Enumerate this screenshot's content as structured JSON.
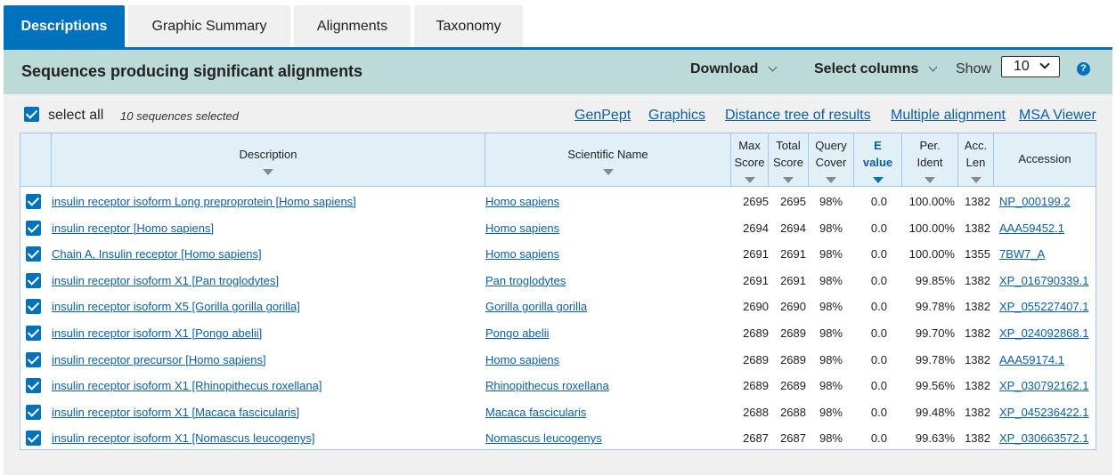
{
  "tabs": [
    "Descriptions",
    "Graphic Summary",
    "Alignments",
    "Taxonomy"
  ],
  "header": {
    "title": "Sequences producing significant alignments",
    "download_label": "Download",
    "select_columns_label": "Select columns",
    "show_label": "Show",
    "show_value": "10",
    "help_icon": "?"
  },
  "selection": {
    "select_all_label": "select all",
    "count_label": "10 sequences selected"
  },
  "links": [
    "GenPept",
    "Graphics",
    "Distance tree of results",
    "Multiple alignment",
    "MSA Viewer"
  ],
  "columns": {
    "description": "Description",
    "scientific_name": "Scientific Name",
    "max_score": [
      "Max",
      "Score"
    ],
    "total_score": [
      "Total",
      "Score"
    ],
    "query_cover": [
      "Query",
      "Cover"
    ],
    "e_value": [
      "E",
      "value"
    ],
    "per_ident": [
      "Per.",
      "Ident"
    ],
    "acc_len": [
      "Acc.",
      "Len"
    ],
    "accession": "Accession"
  },
  "rows": [
    {
      "description": "insulin receptor isoform Long preproprotein [Homo sapiens]",
      "scientific_name": "Homo sapiens",
      "max_score": "2695",
      "total_score": "2695",
      "query_cover": "98%",
      "e_value": "0.0",
      "per_ident": "100.00%",
      "acc_len": "1382",
      "accession": "NP_000199.2"
    },
    {
      "description": "insulin receptor [Homo sapiens]",
      "scientific_name": "Homo sapiens",
      "max_score": "2694",
      "total_score": "2694",
      "query_cover": "98%",
      "e_value": "0.0",
      "per_ident": "100.00%",
      "acc_len": "1382",
      "accession": "AAA59452.1"
    },
    {
      "description": "Chain A, Insulin receptor [Homo sapiens]",
      "scientific_name": "Homo sapiens",
      "max_score": "2691",
      "total_score": "2691",
      "query_cover": "98%",
      "e_value": "0.0",
      "per_ident": "100.00%",
      "acc_len": "1355",
      "accession": "7BW7_A"
    },
    {
      "description": "insulin receptor isoform X1 [Pan troglodytes]",
      "scientific_name": "Pan troglodytes",
      "max_score": "2691",
      "total_score": "2691",
      "query_cover": "98%",
      "e_value": "0.0",
      "per_ident": "99.85%",
      "acc_len": "1382",
      "accession": "XP_016790339.1"
    },
    {
      "description": "insulin receptor isoform X5 [Gorilla gorilla gorilla]",
      "scientific_name": "Gorilla gorilla gorilla",
      "max_score": "2690",
      "total_score": "2690",
      "query_cover": "98%",
      "e_value": "0.0",
      "per_ident": "99.78%",
      "acc_len": "1382",
      "accession": "XP_055227407.1"
    },
    {
      "description": "insulin receptor isoform X1 [Pongo abelii]",
      "scientific_name": "Pongo abelii",
      "max_score": "2689",
      "total_score": "2689",
      "query_cover": "98%",
      "e_value": "0.0",
      "per_ident": "99.70%",
      "acc_len": "1382",
      "accession": "XP_024092868.1"
    },
    {
      "description": "insulin receptor precursor [Homo sapiens]",
      "scientific_name": "Homo sapiens",
      "max_score": "2689",
      "total_score": "2689",
      "query_cover": "98%",
      "e_value": "0.0",
      "per_ident": "99.78%",
      "acc_len": "1382",
      "accession": "AAA59174.1"
    },
    {
      "description": "insulin receptor isoform X1 [Rhinopithecus roxellana]",
      "scientific_name": "Rhinopithecus roxellana",
      "max_score": "2689",
      "total_score": "2689",
      "query_cover": "98%",
      "e_value": "0.0",
      "per_ident": "99.56%",
      "acc_len": "1382",
      "accession": "XP_030792162.1"
    },
    {
      "description": "insulin receptor isoform X1 [Macaca fascicularis]",
      "scientific_name": "Macaca fascicularis",
      "max_score": "2688",
      "total_score": "2688",
      "query_cover": "98%",
      "e_value": "0.0",
      "per_ident": "99.48%",
      "acc_len": "1382",
      "accession": "XP_045236422.1"
    },
    {
      "description": "insulin receptor isoform X1 [Nomascus leucogenys]",
      "scientific_name": "Nomascus leucogenys",
      "max_score": "2687",
      "total_score": "2687",
      "query_cover": "98%",
      "e_value": "0.0",
      "per_ident": "99.63%",
      "acc_len": "1382",
      "accession": "XP_030663572.1"
    }
  ],
  "colors": {
    "primary_blue": "#0071bc",
    "header_bar": "#bcdad8",
    "table_header": "#e0f0f6",
    "link": "#0b5ea7"
  }
}
